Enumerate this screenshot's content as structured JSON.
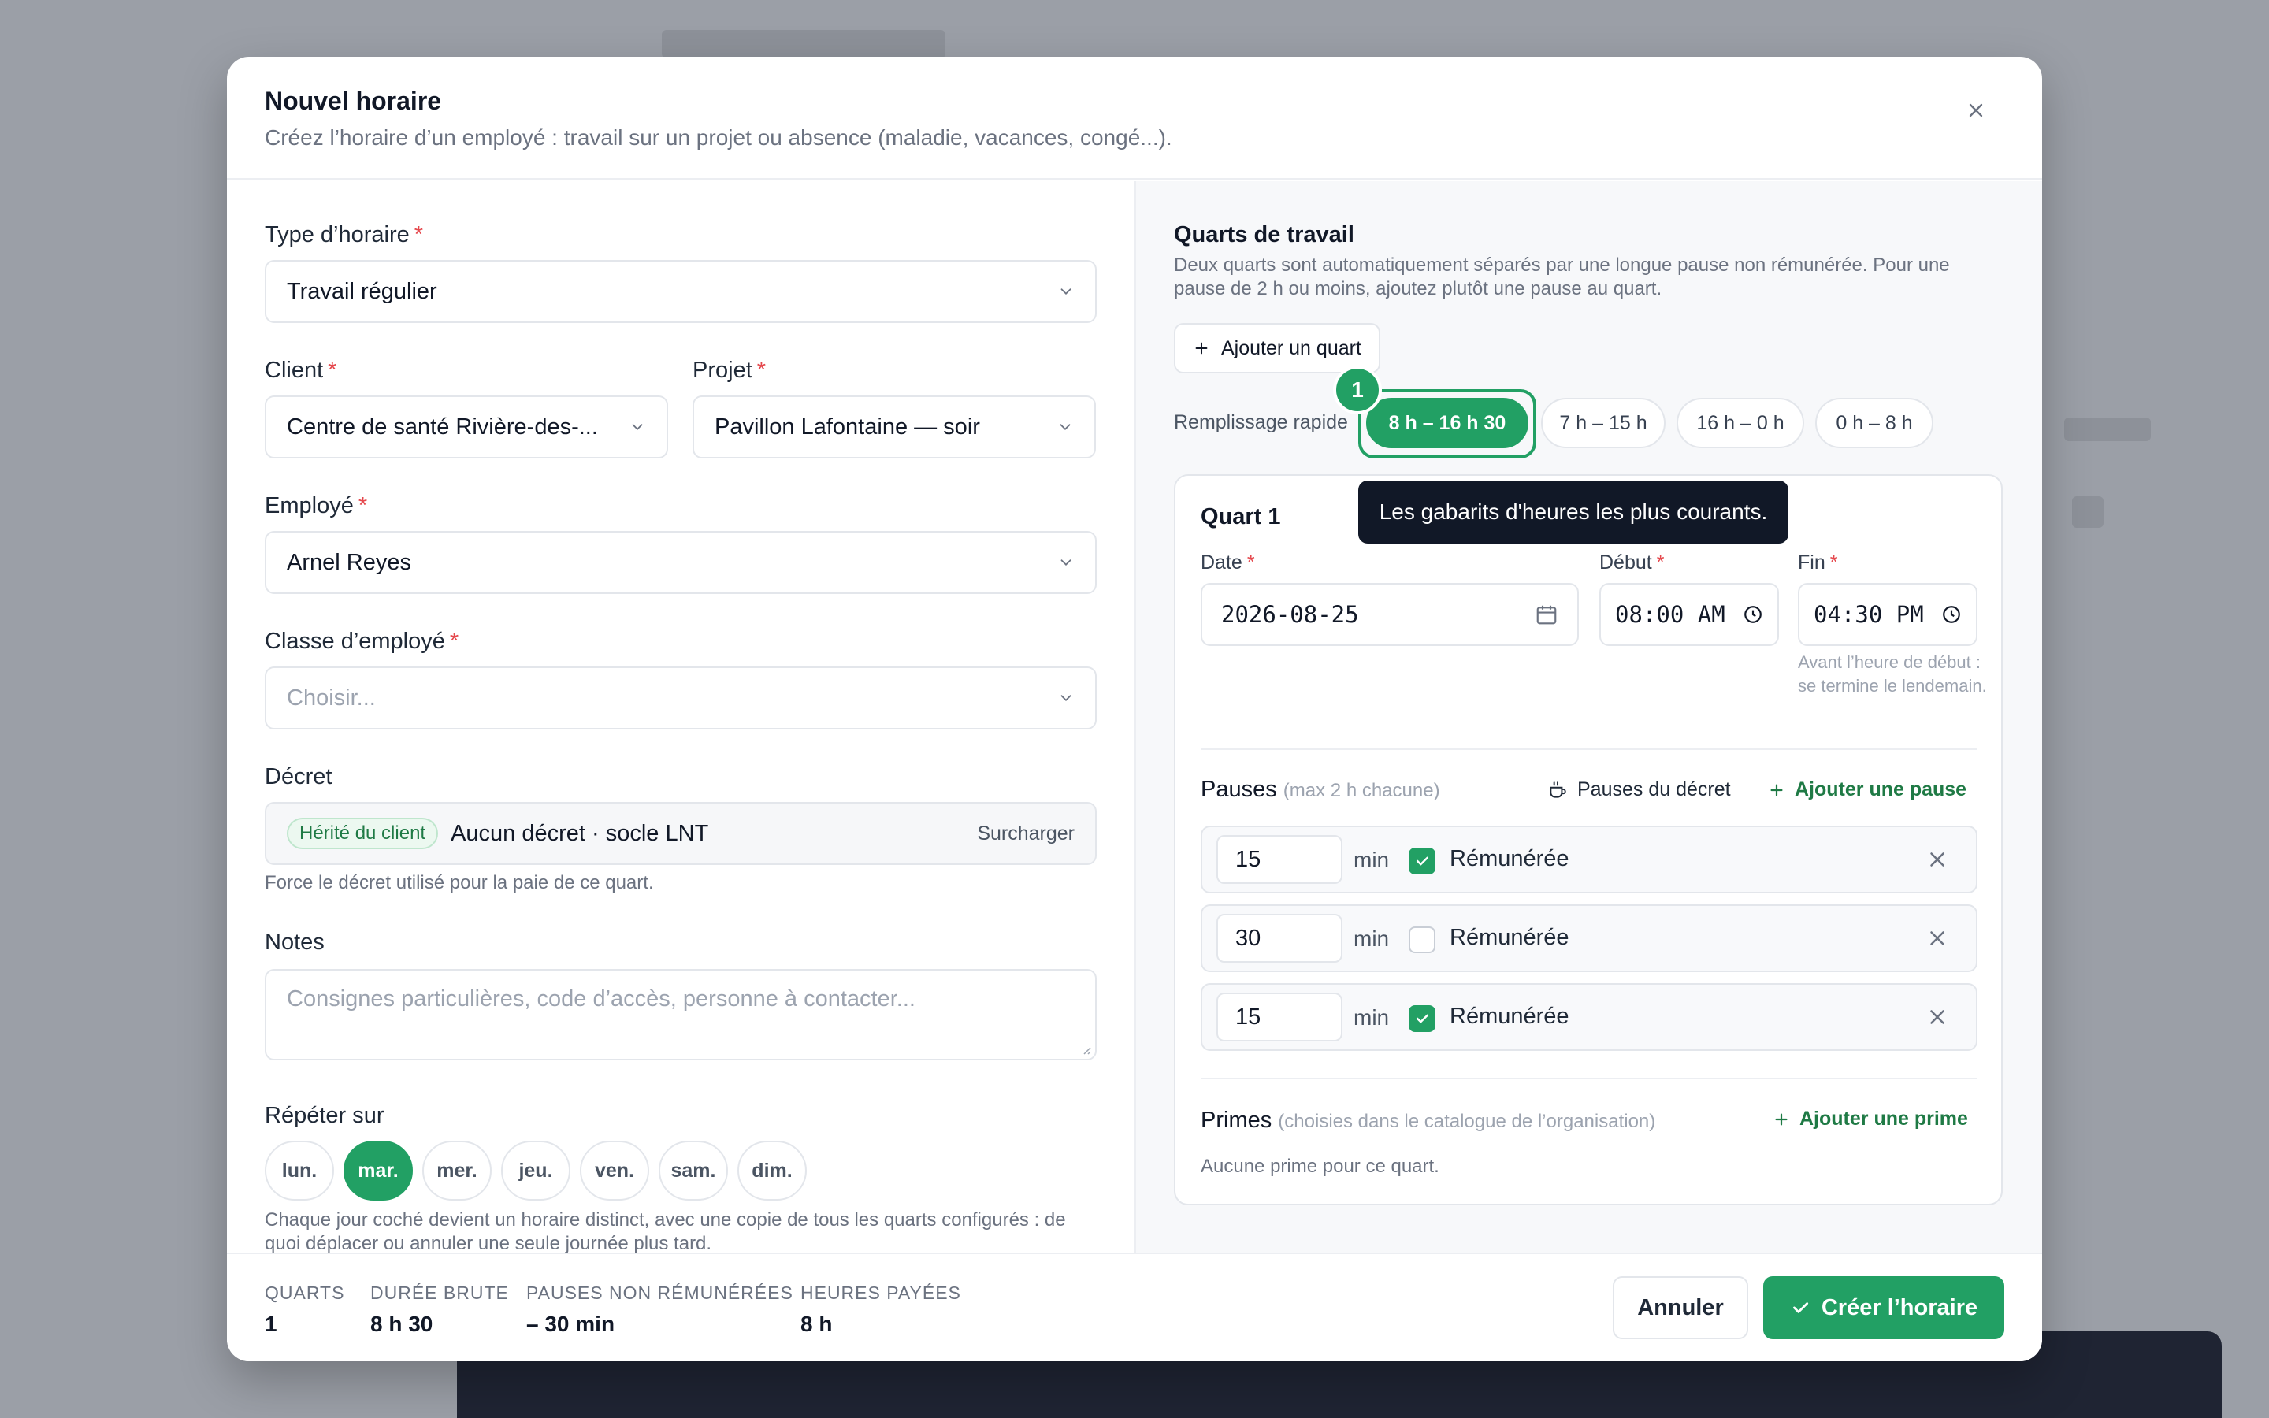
{
  "modal": {
    "title": "Nouvel horaire",
    "subtitle": "Créez l’horaire d’un employé : travail sur un projet ou absence (maladie, vacances, congé...)."
  },
  "form": {
    "type_label": "Type d’horaire",
    "type_value": "Travail régulier",
    "client_label": "Client",
    "client_value": "Centre de santé Rivière-des-...",
    "projet_label": "Projet",
    "projet_value": "Pavillon Lafontaine — soir",
    "employe_label": "Employé",
    "employe_value": "Arnel Reyes",
    "classe_label": "Classe d’employé",
    "classe_placeholder": "Choisir...",
    "decret_label": "Décret",
    "decret_badge": "Hérité du client",
    "decret_value": "Aucun décret · socle LNT",
    "decret_action": "Surcharger",
    "decret_help": "Force le décret utilisé pour la paie de ce quart.",
    "notes_label": "Notes",
    "notes_placeholder": "Consignes particulières, code d’accès, personne à contacter...",
    "repeat_label": "Répéter sur",
    "days": [
      {
        "label": "lun.",
        "active": false
      },
      {
        "label": "mar.",
        "active": true
      },
      {
        "label": "mer.",
        "active": false
      },
      {
        "label": "jeu.",
        "active": false
      },
      {
        "label": "ven.",
        "active": false
      },
      {
        "label": "sam.",
        "active": false
      },
      {
        "label": "dim.",
        "active": false
      }
    ],
    "repeat_help": "Chaque jour coché devient un horaire distinct, avec une copie de tous les quarts configurés : de quoi déplacer ou annuler une seule journée plus tard."
  },
  "shifts": {
    "title": "Quarts de travail",
    "description": "Deux quarts sont automatiquement séparés par une longue pause non rémunérée. Pour une pause de 2 h ou moins, ajoutez plutôt une pause au quart.",
    "add_shift": "Ajouter un quart",
    "quick_fill_label": "Remplissage rapide",
    "quick_fill": [
      "8 h – 16 h 30",
      "7 h – 15 h",
      "16 h – 0 h",
      "0 h – 8 h"
    ],
    "quick_fill_active_index": 0,
    "step_badge": "1",
    "tooltip": "Les gabarits d'heures les plus courants.",
    "shift_title": "Quart 1",
    "date_label": "Date",
    "date_value": "2026-08-25",
    "start_label": "Début",
    "start_value": "08:00 AM",
    "end_label": "Fin",
    "end_value": "04:30 PM",
    "end_help": "Avant l’heure de début : se termine le lendemain.",
    "pauses_label": "Pauses",
    "pauses_hint": "(max 2 h chacune)",
    "decret_pauses": "Pauses du décret",
    "add_pause": "Ajouter une pause",
    "pauses": [
      {
        "minutes": "15",
        "unit": "min",
        "paid": true,
        "paid_label": "Rémunérée"
      },
      {
        "minutes": "30",
        "unit": "min",
        "paid": false,
        "paid_label": "Rémunérée"
      },
      {
        "minutes": "15",
        "unit": "min",
        "paid": true,
        "paid_label": "Rémunérée"
      }
    ],
    "primes_label": "Primes",
    "primes_hint": "(choisies dans le catalogue de l’organisation)",
    "add_prime": "Ajouter une prime",
    "primes_empty": "Aucune prime pour ce quart."
  },
  "footer": {
    "stats": [
      {
        "label": "QUARTS",
        "value": "1"
      },
      {
        "label": "DURÉE BRUTE",
        "value": "8 h 30"
      },
      {
        "label": "PAUSES NON RÉMUNÉRÉES",
        "value": "– 30 min"
      },
      {
        "label": "HEURES PAYÉES",
        "value": "8 h"
      }
    ],
    "cancel": "Annuler",
    "create": "Créer l’horaire"
  },
  "colors": {
    "accent": "#22a064",
    "required": "#e5484d",
    "tooltip_bg": "#111827"
  }
}
